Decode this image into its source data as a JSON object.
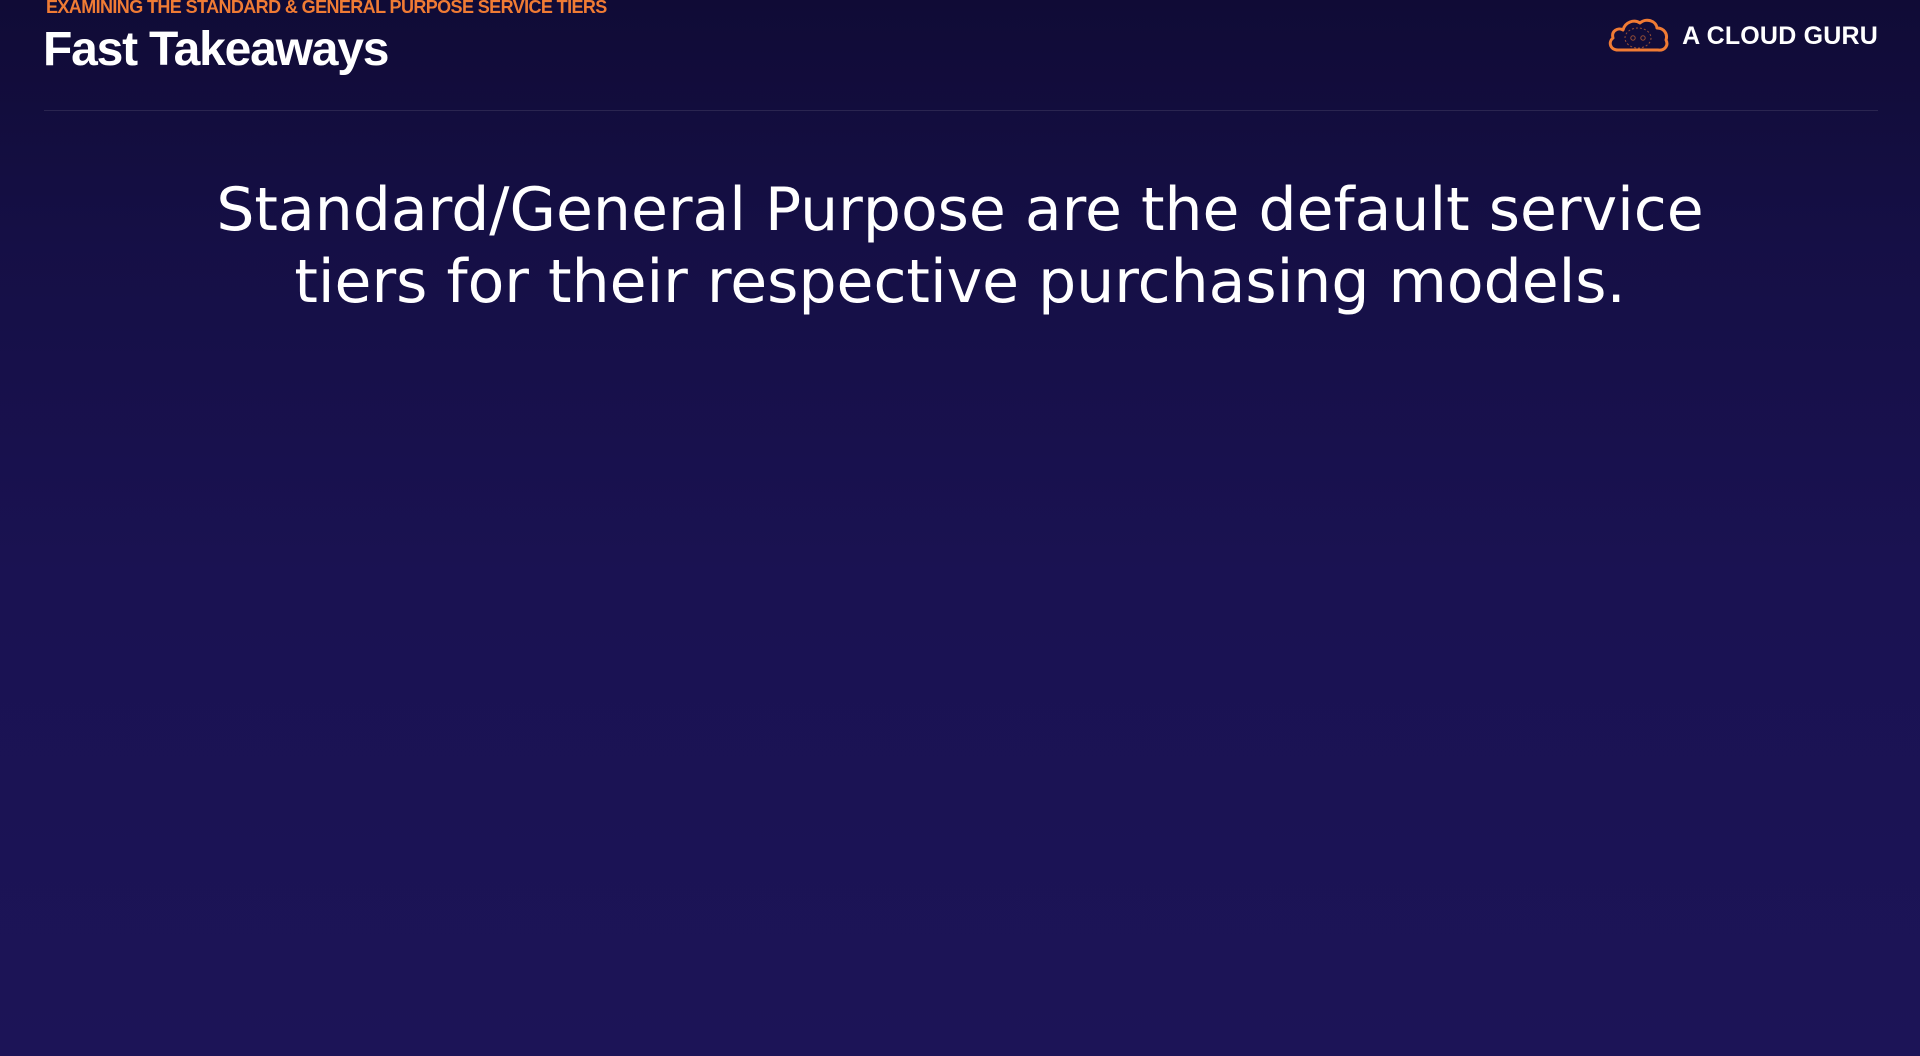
{
  "slide": {
    "eyebrow": "EXAMINING THE STANDARD & GENERAL PURPOSE SERVICE TIERS",
    "title": "Fast Takeaways",
    "brand": {
      "name": "A CLOUD GURU",
      "icon": "cloud-logo-icon",
      "accent_color": "#f07b34"
    },
    "takeaway_lines": [
      "Standard/General Purpose are the default service",
      "tiers for their respective purchasing models."
    ]
  },
  "colors": {
    "background": "#1a1252",
    "eyebrow": "#f07b34",
    "text": "#ffffff"
  }
}
